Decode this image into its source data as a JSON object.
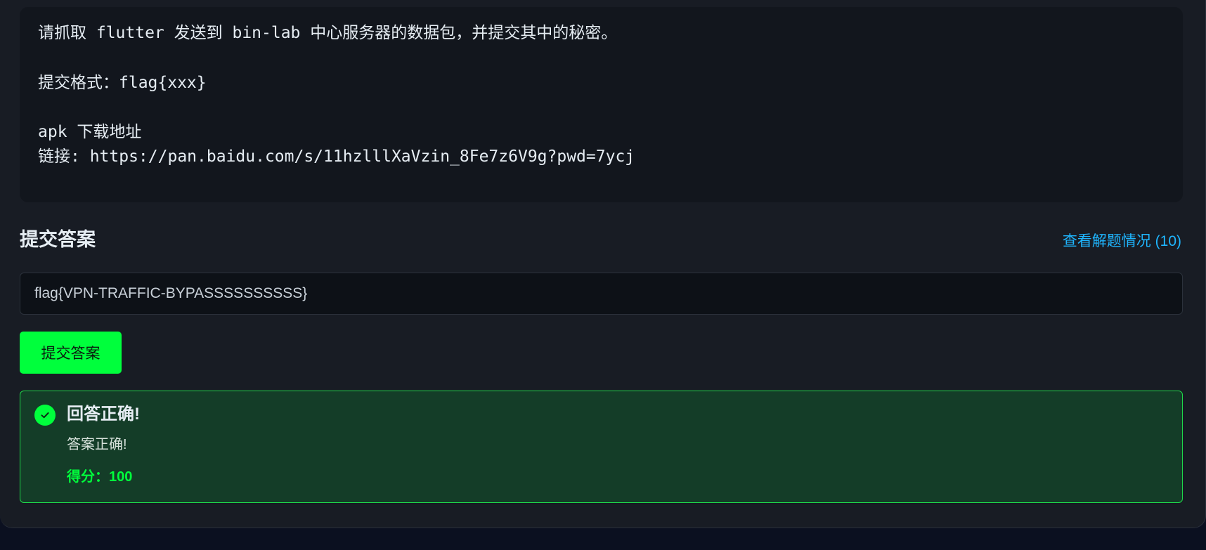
{
  "challenge": {
    "description_lines": [
      "请抓取 flutter 发送到 bin-lab 中心服务器的数据包，并提交其中的秘密。",
      "提交格式：flag{xxx}",
      "apk 下载地址",
      "链接: https://pan.baidu.com/s/11hzlllXaVzin_8Fe7z6V9g?pwd=7ycj"
    ]
  },
  "submit_section": {
    "title": "提交答案",
    "solves_link": "查看解题情况 (10)",
    "answer_value": "flag{VPN-TRAFFIC-BYPASSSSSSSSSS}",
    "submit_label": "提交答案"
  },
  "result": {
    "status": "success",
    "icon": "check-circle-icon",
    "title": "回答正确!",
    "message": "答案正确!",
    "score": "得分：100"
  },
  "colors": {
    "accent_green": "#00ff3c",
    "link_blue": "#1fb6ff",
    "success_bg": "#143d28",
    "panel_bg": "#181c24"
  }
}
